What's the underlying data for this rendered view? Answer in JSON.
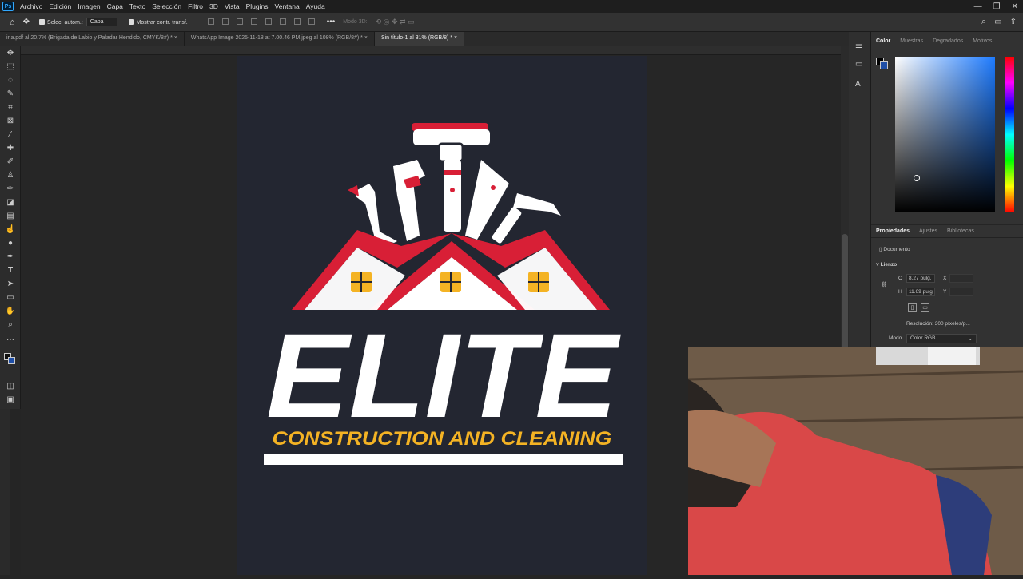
{
  "menu": {
    "app_icon": "Ps",
    "items": [
      "Archivo",
      "Edición",
      "Imagen",
      "Capa",
      "Texto",
      "Selección",
      "Filtro",
      "3D",
      "Vista",
      "Plugins",
      "Ventana",
      "Ayuda"
    ]
  },
  "options": {
    "auto_select": "Selec. autom.:",
    "layer_select": "Capa",
    "show_transform": "Mostrar contr. transf.",
    "mode_3d": "Modo 3D:"
  },
  "tabs": [
    {
      "label": "ina.pdf al 20.7% (Brigada de  Labio y Paladar Hendido, CMYK/8#) *"
    },
    {
      "label": "WhatsApp Image 2025-11-18 at 7.00.46 PM.jpeg al 108% (RGB/8#) *"
    },
    {
      "label": "Sin título-1 al 31% (RGB/8) *"
    }
  ],
  "tab_close": "×",
  "logo": {
    "title": "ELITE",
    "subtitle": "CONSTRUCTION AND CLEANING",
    "bg_color": "#232631",
    "red": "#d81f36",
    "gold": "#f4b324"
  },
  "color_panel": {
    "tabs": [
      "Color",
      "Muestras",
      "Degradados",
      "Motivos"
    ]
  },
  "properties": {
    "tabs": [
      "Propiedades",
      "Ajustes",
      "Bibliotecas"
    ],
    "document": "Documento",
    "section": "Lienzo",
    "w_label": "O",
    "w_value": "8.27 pulg.",
    "h_label": "H",
    "h_value": "11.69 pulg",
    "x_label": "X",
    "y_label": "Y",
    "resolution": "Resolución: 300 píxeles/p...",
    "mode_label": "Modo",
    "mode_value": "Color RGB"
  }
}
